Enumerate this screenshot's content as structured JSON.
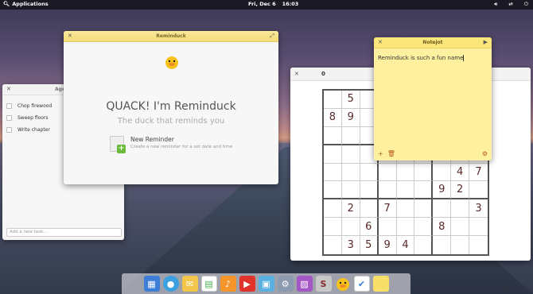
{
  "topbar": {
    "applications_label": "Applications",
    "date": "Fri, Dec 6",
    "time": "16:03"
  },
  "agenda": {
    "title": "Age",
    "tasks": [
      "Chop firewood",
      "Sweep floors",
      "Write chapter"
    ],
    "new_task_placeholder": "Add a new task..."
  },
  "reminduck": {
    "title": "Reminduck",
    "heading": "QUACK! I'm Reminduck",
    "subheading": "The duck that reminds you",
    "new_reminder_title": "New Reminder",
    "new_reminder_desc": "Create a new reminder for a set date and time"
  },
  "sudoku": {
    "title": "0",
    "cells": [
      [
        "",
        "5",
        "",
        "",
        "",
        "",
        "",
        "",
        ""
      ],
      [
        "8",
        "9",
        "",
        "",
        "",
        "",
        "",
        "",
        ""
      ],
      [
        "",
        "",
        "",
        "",
        "",
        "",
        "",
        "",
        ""
      ],
      [
        "",
        "",
        "",
        "",
        "",
        "",
        "",
        "",
        ""
      ],
      [
        "",
        "",
        "",
        "",
        "",
        "",
        "",
        "4",
        "7"
      ],
      [
        "",
        "",
        "",
        "",
        "",
        "",
        "9",
        "2",
        ""
      ],
      [
        "",
        "2",
        "",
        "7",
        "",
        "",
        "",
        "",
        "3"
      ],
      [
        "",
        "",
        "6",
        "",
        "",
        "",
        "8",
        "",
        ""
      ],
      [
        "",
        "3",
        "5",
        "9",
        "4",
        "",
        "",
        "",
        ""
      ]
    ]
  },
  "notejot": {
    "title": "Notejot",
    "note_text": "Reminduck is such a fun name"
  },
  "dock": {
    "apps": [
      "multitasking-view",
      "web-browser",
      "mail",
      "calendar",
      "music",
      "videos",
      "photos",
      "switchboard",
      "appcenter",
      "sudoku",
      "reminduck",
      "tasks",
      "notejot"
    ]
  },
  "colors": {
    "reminduck_titlebar": "#f4dc78",
    "notejot_bg": "#fdf1a0",
    "sudoku_digit": "#5a2a2a"
  }
}
